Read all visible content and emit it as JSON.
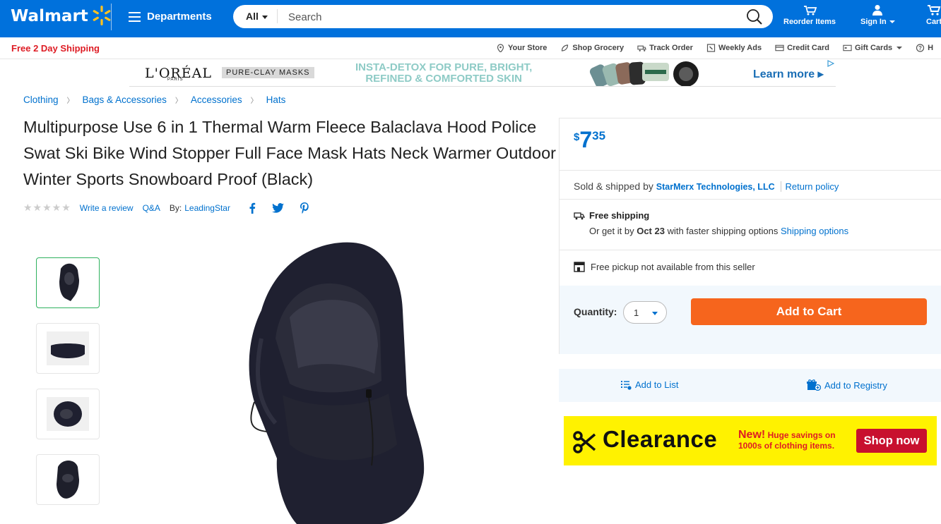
{
  "header": {
    "logo_text": "Walmart",
    "departments_label": "Departments",
    "search": {
      "category": "All",
      "placeholder": "Search"
    },
    "reorder_label": "Reorder Items",
    "signin_label": "Sign In",
    "cart_label": "Cart",
    "accent": "#0071dc",
    "spark_color": "#ffc220"
  },
  "subbar": {
    "free_shipping": "Free 2 Day Shipping",
    "links": [
      "Your Store",
      "Shop Grocery",
      "Track Order",
      "Weekly Ads",
      "Credit Card",
      "Gift Cards",
      "H"
    ]
  },
  "ad": {
    "brand": "L'ORÉAL",
    "brand_sub": "PARIS",
    "product_tag": "PURE-CLAY MASKS",
    "headline_1": "INSTA-DETOX FOR PURE, BRIGHT,",
    "headline_2": "REFINED & COMFORTED SKIN",
    "cta": "Learn more"
  },
  "breadcrumb": [
    "Clothing",
    "Bags & Accessories",
    "Accessories",
    "Hats"
  ],
  "product": {
    "title": "Multipurpose Use 6 in 1 Thermal Warm Fleece Balaclava Hood Police Swat Ski Bike Wind Stopper Full Face Mask Hats Neck Warmer Outdoor Winter Sports Snowboard Proof (Black)",
    "stars": "★★★★★",
    "rating": 0,
    "write_review": "Write a review",
    "qa": "Q&A",
    "by_label": "By:",
    "brand": "LeadingStar",
    "thumbnail_count": 4
  },
  "offer": {
    "price_symbol": "$",
    "price_dollars": "7",
    "price_cents": "35",
    "sold_by_label": "Sold & shipped by",
    "seller": "StarMerx Technologies, LLC",
    "return_policy": "Return policy",
    "free_shipping": "Free shipping",
    "ship_prefix": "Or get it by",
    "ship_date": "Oct 23",
    "ship_suffix": "with faster shipping options",
    "shipping_options": "Shipping options",
    "pickup": "Free pickup not available from this seller",
    "quantity_label": "Quantity:",
    "quantity_value": "1",
    "add_to_cart": "Add to Cart",
    "add_to_list": "Add to List",
    "add_to_registry": "Add to Registry",
    "cta_color": "#f6651d"
  },
  "promo": {
    "title": "Clearance",
    "new_label": "New!",
    "line1": "Huge savings on",
    "line2": "1000s of clothing items.",
    "button": "Shop now"
  }
}
